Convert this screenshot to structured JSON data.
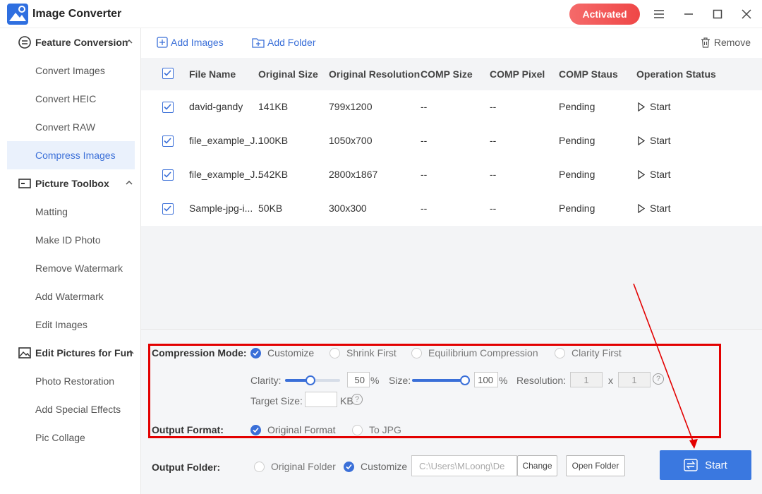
{
  "app": {
    "title": "Image Converter",
    "activated": "Activated",
    "brand_color": "#3a78e0"
  },
  "sidebar": {
    "sections": [
      {
        "label": "Feature Conversion",
        "icon": "conversion-icon",
        "items": [
          "Convert Images",
          "Convert HEIC",
          "Convert RAW",
          "Compress Images"
        ]
      },
      {
        "label": "Picture Toolbox",
        "icon": "toolbox-icon",
        "items": [
          "Matting",
          "Make ID Photo",
          "Remove Watermark",
          "Add Watermark",
          "Edit Images"
        ]
      },
      {
        "label": "Edit Pictures for Fun",
        "icon": "picture-icon",
        "items": [
          "Photo Restoration",
          "Add Special Effects",
          "Pic Collage"
        ]
      }
    ],
    "active_item": "Compress Images"
  },
  "toolbar": {
    "add_images": "Add Images",
    "add_folder": "Add Folder",
    "remove": "Remove"
  },
  "table": {
    "columns": [
      "File Name",
      "Original Size",
      "Original Resolution",
      "COMP Size",
      "COMP Pixel",
      "COMP Staus",
      "Operation Status"
    ],
    "rows": [
      {
        "name": "david-gandy",
        "size": "141KB",
        "resolution": "799x1200",
        "comp_size": "--",
        "comp_pixel": "--",
        "status": "Pending",
        "op": "Start"
      },
      {
        "name": "file_example_J...",
        "size": "100KB",
        "resolution": "1050x700",
        "comp_size": "--",
        "comp_pixel": "--",
        "status": "Pending",
        "op": "Start"
      },
      {
        "name": "file_example_J...",
        "size": "542KB",
        "resolution": "2800x1867",
        "comp_size": "--",
        "comp_pixel": "--",
        "status": "Pending",
        "op": "Start"
      },
      {
        "name": "Sample-jpg-i...",
        "size": "50KB",
        "resolution": "300x300",
        "comp_size": "--",
        "comp_pixel": "--",
        "status": "Pending",
        "op": "Start"
      }
    ]
  },
  "settings": {
    "compression_mode_label": "Compression Mode:",
    "modes": [
      "Customize",
      "Shrink First",
      "Equilibrium Compression",
      "Clarity First"
    ],
    "selected_mode": "Customize",
    "clarity_label": "Clarity:",
    "clarity_value": "50",
    "clarity_fraction": 0.5,
    "percent": "%",
    "size_label": "Size:",
    "size_value": "100",
    "size_fraction": 1.0,
    "resolution_label": "Resolution:",
    "res_w": "1",
    "res_x": "x",
    "res_h": "1",
    "target_size_label": "Target Size:",
    "target_size_unit": "KB",
    "output_format_label": "Output Format:",
    "formats": [
      "Original Format",
      "To JPG"
    ],
    "selected_format": "Original Format",
    "output_folder_label": "Output Folder:",
    "folder_options": [
      "Original Folder",
      "Customize"
    ],
    "selected_folder": "Customize",
    "path": "C:\\Users\\MLoong\\De",
    "change": "Change",
    "open_folder": "Open Folder",
    "start": "Start"
  }
}
